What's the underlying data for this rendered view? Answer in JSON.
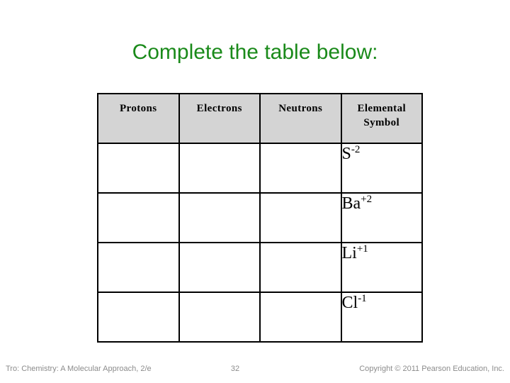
{
  "slide": {
    "title": "Complete the table below:",
    "title_color": "#1a8a1a",
    "background_color": "#ffffff"
  },
  "table": {
    "header_background": "#d4d4d4",
    "border_color": "#000000",
    "columns": [
      {
        "label": "Protons"
      },
      {
        "label": "Electrons"
      },
      {
        "label": "Neutrons"
      },
      {
        "label": "Elemental Symbol"
      }
    ],
    "rows": [
      {
        "protons": "",
        "electrons": "",
        "neutrons": "",
        "symbol_base": "S",
        "symbol_charge": "-2"
      },
      {
        "protons": "",
        "electrons": "",
        "neutrons": "",
        "symbol_base": "Ba",
        "symbol_charge": "+2"
      },
      {
        "protons": "",
        "electrons": "",
        "neutrons": "",
        "symbol_base": "Li",
        "symbol_charge": "+1"
      },
      {
        "protons": "",
        "electrons": "",
        "neutrons": "",
        "symbol_base": "Cl",
        "symbol_charge": "-1"
      }
    ]
  },
  "footer": {
    "source": "Tro: Chemistry: A Molecular Approach, 2/e",
    "page_number": "32",
    "copyright": "Copyright © 2011 Pearson Education, Inc."
  }
}
